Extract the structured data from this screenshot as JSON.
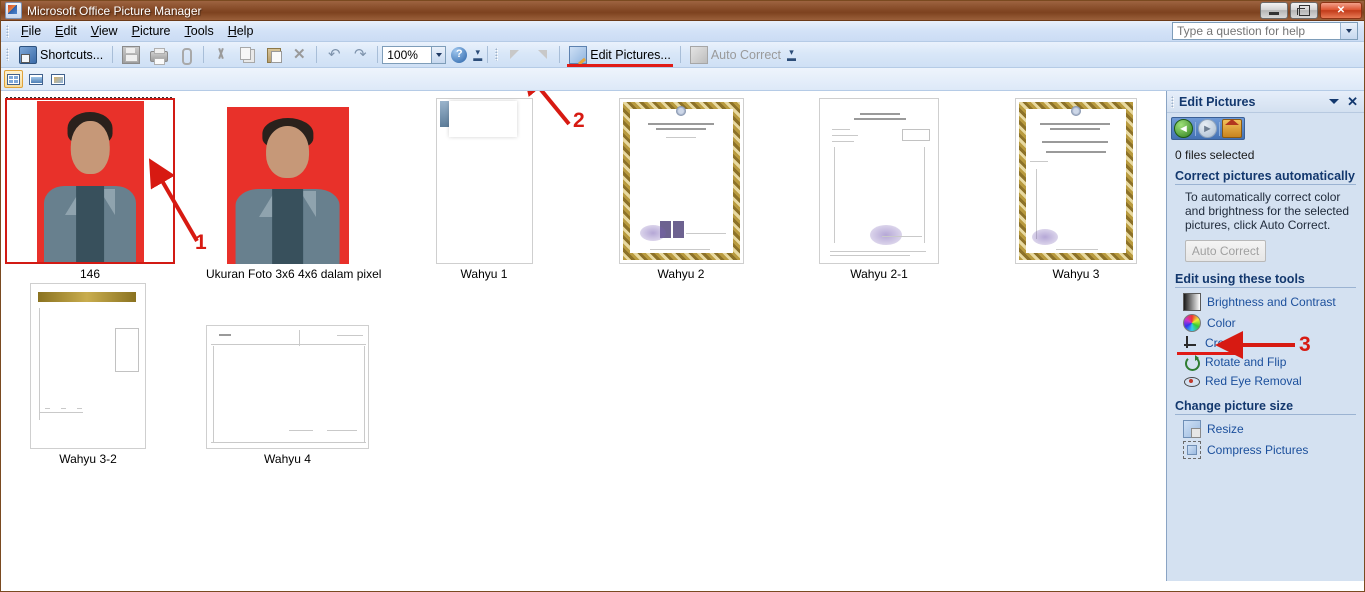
{
  "window": {
    "title": "Microsoft Office Picture Manager",
    "minimize_label": "Minimize",
    "restore_label": "Restore",
    "close_label": "Close"
  },
  "menu": {
    "items": [
      {
        "label": "File",
        "accel": "F"
      },
      {
        "label": "Edit",
        "accel": "E"
      },
      {
        "label": "View",
        "accel": "V"
      },
      {
        "label": "Picture",
        "accel": "P"
      },
      {
        "label": "Tools",
        "accel": "T"
      },
      {
        "label": "Help",
        "accel": "H"
      }
    ],
    "help_search_placeholder": "Type a question for help",
    "help_search_value": ""
  },
  "toolbar": {
    "shortcuts_label": "Shortcuts...",
    "save_label": "Save",
    "print_label": "Print",
    "email_label": "E-mail",
    "cut_label": "Cut",
    "copy_label": "Copy",
    "paste_label": "Paste",
    "delete_label": "Delete",
    "undo_label": "Undo",
    "redo_label": "Redo",
    "zoom_value": "100%",
    "help_label": "Help",
    "rotate_left_label": "Rotate Left",
    "rotate_right_label": "Rotate Right",
    "edit_pictures_label": "Edit Pictures...",
    "auto_correct_label": "Auto Correct",
    "overflow_label": "Toolbar Options"
  },
  "view_bar": {
    "thumbnail_view_label": "Thumbnail View",
    "filmstrip_view_label": "Filmstrip View",
    "single_picture_view_label": "Single Picture View",
    "active_view": "Thumbnail View"
  },
  "thumbnails": [
    {
      "caption": "146",
      "type": "photo",
      "selected": true
    },
    {
      "caption": "Ukuran Foto 3x6 4x6 dalam pixel",
      "type": "photo",
      "selected": false
    },
    {
      "caption": "Wahyu 1",
      "type": "doc-blank",
      "selected": false
    },
    {
      "caption": "Wahyu 2",
      "type": "doc-certificate",
      "selected": false
    },
    {
      "caption": "Wahyu 2-1",
      "type": "doc-form",
      "selected": false
    },
    {
      "caption": "Wahyu 3",
      "type": "doc-certificate",
      "selected": false
    },
    {
      "caption": "Wahyu 3-2",
      "type": "doc-gold-header",
      "selected": false
    },
    {
      "caption": "Wahyu 4",
      "type": "doc-landscape",
      "selected": false
    }
  ],
  "annotations": [
    {
      "number": "1",
      "points_to": "146"
    },
    {
      "number": "2",
      "points_to": "Edit Pictures..."
    },
    {
      "number": "3",
      "points_to": "Crop"
    }
  ],
  "task_pane": {
    "title": "Edit Pictures",
    "collapse_label": "Task Pane Options",
    "close_label": "Close",
    "nav_back_label": "Back",
    "nav_forward_label": "Forward",
    "nav_home_label": "Home",
    "files_selected": "0 files selected",
    "auto_section_title": "Correct pictures automatically",
    "auto_description": "To automatically correct color and brightness for the selected pictures, click Auto Correct.",
    "auto_correct_button": "Auto Correct",
    "tools_section_title": "Edit using these tools",
    "tools": [
      {
        "label": "Brightness and Contrast",
        "icon": "brightness-contrast-icon"
      },
      {
        "label": "Color",
        "icon": "color-wheel-icon"
      },
      {
        "label": "Crop",
        "icon": "crop-icon",
        "highlighted": true
      },
      {
        "label": "Rotate and Flip",
        "icon": "rotate-flip-icon"
      },
      {
        "label": "Red Eye Removal",
        "icon": "red-eye-icon"
      }
    ],
    "size_section_title": "Change picture size",
    "size_tools": [
      {
        "label": "Resize",
        "icon": "resize-icon"
      },
      {
        "label": "Compress Pictures",
        "icon": "compress-icon"
      }
    ]
  },
  "colors": {
    "annotation_red": "#d71a12",
    "titlebar_brown": "#8a4f2c",
    "taskpane_bg": "#d4e1f1",
    "link_blue": "#1b4f9c",
    "heading_blue": "#13386e",
    "selection_red": "#d21a14"
  }
}
